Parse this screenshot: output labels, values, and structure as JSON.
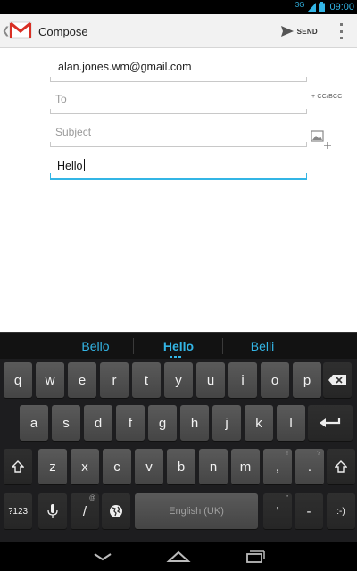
{
  "status_bar": {
    "network": "3G",
    "time": "09:00"
  },
  "action_bar": {
    "title": "Compose",
    "send_label": "SEND"
  },
  "compose": {
    "from_account": "alan.jones.wm@gmail.com",
    "to_placeholder": "To",
    "cc_bcc_label": "+ CC/BCC",
    "subject_placeholder": "Subject",
    "body_text": "Hello"
  },
  "keyboard": {
    "suggestions": [
      "Bello",
      "Hello",
      "Belli"
    ],
    "row1": [
      {
        "label": "q",
        "hint": ""
      },
      {
        "label": "w",
        "hint": ""
      },
      {
        "label": "e",
        "hint": ""
      },
      {
        "label": "r",
        "hint": ""
      },
      {
        "label": "t",
        "hint": ""
      },
      {
        "label": "y",
        "hint": ""
      },
      {
        "label": "u",
        "hint": ""
      },
      {
        "label": "i",
        "hint": ""
      },
      {
        "label": "o",
        "hint": ""
      },
      {
        "label": "p",
        "hint": ""
      }
    ],
    "row2": [
      {
        "label": "a",
        "hint": ""
      },
      {
        "label": "s",
        "hint": ""
      },
      {
        "label": "d",
        "hint": ""
      },
      {
        "label": "f",
        "hint": ""
      },
      {
        "label": "g",
        "hint": ""
      },
      {
        "label": "h",
        "hint": ""
      },
      {
        "label": "j",
        "hint": ""
      },
      {
        "label": "k",
        "hint": ""
      },
      {
        "label": "l",
        "hint": ""
      }
    ],
    "row3": [
      {
        "label": "z",
        "hint": ""
      },
      {
        "label": "x",
        "hint": ""
      },
      {
        "label": "c",
        "hint": ""
      },
      {
        "label": "v",
        "hint": ""
      },
      {
        "label": "b",
        "hint": ""
      },
      {
        "label": "n",
        "hint": ""
      },
      {
        "label": "m",
        "hint": ""
      },
      {
        "label": ",",
        "hint": "!"
      },
      {
        "label": ".",
        "hint": "?"
      }
    ],
    "symbols_label": "?123",
    "slash": {
      "label": "/",
      "hint": "@"
    },
    "space_label": "English (UK)",
    "apostrophe": {
      "label": "'",
      "hint": "\""
    },
    "dash": {
      "label": "-",
      "hint": "_"
    },
    "smiley_label": ":-)"
  },
  "icons": {
    "app_logo": "gmail-logo",
    "send": "send-arrow-icon",
    "overflow": "overflow-menu-icon",
    "attach": "attach-picture-icon",
    "delete": "backspace-icon",
    "enter": "enter-icon",
    "shift": "shift-icon",
    "mic": "microphone-icon",
    "globe": "globe-icon",
    "back": "nav-back-icon",
    "home": "nav-home-icon",
    "recents": "nav-recents-icon"
  },
  "colors": {
    "accent": "#33b5e5",
    "action_bar": "#f2f2f2",
    "keyboard": "#1d1d1f"
  }
}
